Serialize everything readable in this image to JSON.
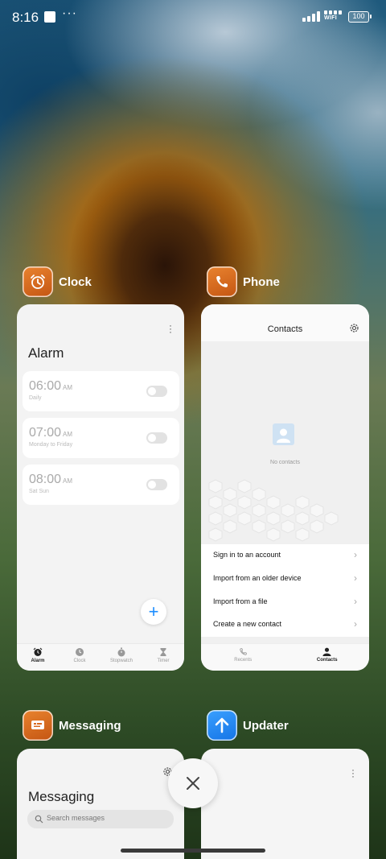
{
  "status_bar": {
    "time": "8:16",
    "dots": "···",
    "wifi_label": "WIFI",
    "battery": "100"
  },
  "recent_apps": [
    {
      "name": "Clock",
      "icon": "alarm-clock-icon",
      "screen": {
        "title": "Alarm",
        "alarms": [
          {
            "time": "06:00",
            "ampm": "AM",
            "repeat": "Daily",
            "enabled": false
          },
          {
            "time": "07:00",
            "ampm": "AM",
            "repeat": "Monday to Friday",
            "enabled": false
          },
          {
            "time": "08:00",
            "ampm": "AM",
            "repeat": "Sat Sun",
            "enabled": false
          }
        ],
        "tabs": [
          "Alarm",
          "Clock",
          "Stopwatch",
          "Timer"
        ],
        "active_tab": "Alarm"
      }
    },
    {
      "name": "Phone",
      "icon": "phone-icon",
      "screen": {
        "title": "Contacts",
        "empty_text": "No contacts",
        "menu": [
          "Sign in to an account",
          "Import from an older device",
          "Import from a file",
          "Create a new contact"
        ],
        "tabs": [
          "Recents",
          "Contacts"
        ],
        "active_tab": "Contacts"
      }
    },
    {
      "name": "Messaging",
      "icon": "message-icon",
      "screen": {
        "title": "Messaging",
        "search_placeholder": "Search messages"
      }
    },
    {
      "name": "Updater",
      "icon": "upload-arrow-icon",
      "screen": {}
    }
  ],
  "colors": {
    "orange_icon": "#d9691f",
    "blue_icon": "#2488f5",
    "accent": "#1a8cff"
  }
}
